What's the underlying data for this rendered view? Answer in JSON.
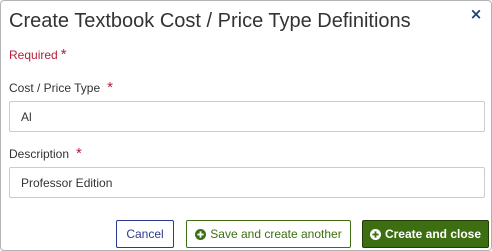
{
  "dialog": {
    "title": "Create Textbook Cost / Price Type Definitions",
    "close_glyph": "×",
    "close_icon": "close-icon"
  },
  "required_note": {
    "text": "Required",
    "marker": "*"
  },
  "fields": {
    "cost_price_type": {
      "label": "Cost / Price Type",
      "required_marker": "*",
      "value": "Al"
    },
    "description": {
      "label": "Description",
      "required_marker": "*",
      "value": "Professor Edition"
    }
  },
  "buttons": {
    "cancel_label": "Cancel",
    "save_another_label": "Save and create another",
    "save_another_icon": "plus-circle-icon",
    "create_close_label": "Create and close",
    "create_close_icon": "plus-circle-icon"
  },
  "colors": {
    "required": "#b5203a",
    "primary_green": "#3e6e12",
    "cancel_blue": "#2b3a8c",
    "close_icon": "#1f3f77"
  }
}
